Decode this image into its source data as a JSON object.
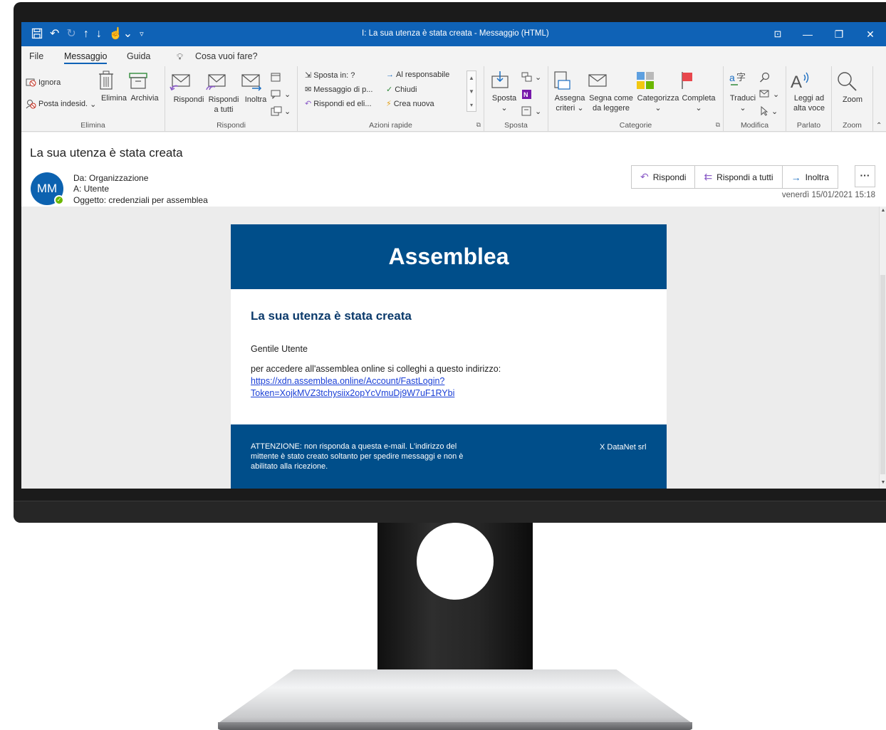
{
  "window": {
    "title": "I: La sua utenza è stata creata  -  Messaggio (HTML)"
  },
  "menu": {
    "file": "File",
    "messaggio": "Messaggio",
    "guida": "Guida",
    "search": "Cosa vuoi fare?"
  },
  "ribbon": {
    "elimina": {
      "ignora": "Ignora",
      "posta_indesid": "Posta indesid.",
      "elimina": "Elimina",
      "archivia": "Archivia",
      "label": "Elimina"
    },
    "rispondi": {
      "rispondi": "Rispondi",
      "rispondi_tutti_1": "Rispondi",
      "rispondi_tutti_2": "a tutti",
      "inoltra": "Inoltra",
      "label": "Rispondi"
    },
    "azioni_rapide": {
      "items": [
        "Sposta in: ?",
        "Messaggio di p...",
        "Rispondi ed eli...",
        "Al responsabile",
        "Chiudi",
        "Crea nuova"
      ],
      "label": "Azioni rapide"
    },
    "sposta": {
      "sposta": "Sposta",
      "label": "Sposta"
    },
    "categorie": {
      "assegna_1": "Assegna",
      "assegna_2": "criteri",
      "segna_1": "Segna come",
      "segna_2": "da leggere",
      "categorizza": "Categorizza",
      "completa": "Completa",
      "label": "Categorie"
    },
    "modifica": {
      "traduci": "Traduci",
      "label": "Modifica"
    },
    "parlato": {
      "leggi_1": "Leggi ad",
      "leggi_2": "alta voce",
      "label": "Parlato"
    },
    "zoom": {
      "zoom": "Zoom",
      "label": "Zoom"
    }
  },
  "message": {
    "subject": "La sua utenza è stata creata",
    "avatar_initials": "MM",
    "from": "Da: Organizzazione",
    "to": "A: Utente",
    "oggetto": "Oggetto: credenziali per assemblea",
    "datetime": "venerdì 15/01/2021 15:18",
    "actions": {
      "rispondi": "Rispondi",
      "rispondi_tutti": "Rispondi a tutti",
      "inoltra": "Inoltra",
      "more": "···"
    }
  },
  "email": {
    "brand": "Assemblea",
    "title": "La sua utenza è stata creata",
    "greeting": "Gentile Utente",
    "intro": "per accedere all'assemblea online si colleghi a questo indirizzo:",
    "link_line1": "https://xdn.assemblea.online/Account/FastLogin?",
    "link_line2": "Token=XojkMVZ3tchysiix2opYcVmuDj9W7uF1RYbi",
    "footer_line1": "ATTENZIONE: non risponda a questa e-mail. L'indirizzo del",
    "footer_line2": "mittente è stato creato soltanto per spedire messaggi e non è",
    "footer_line3": "abilitato alla ricezione.",
    "footer_brand": "X DataNet srl"
  },
  "colors": {
    "titlebar": "#0f62b6",
    "email_header": "#004e8a",
    "link": "#1a3fd6",
    "presence": "#6bb700"
  }
}
